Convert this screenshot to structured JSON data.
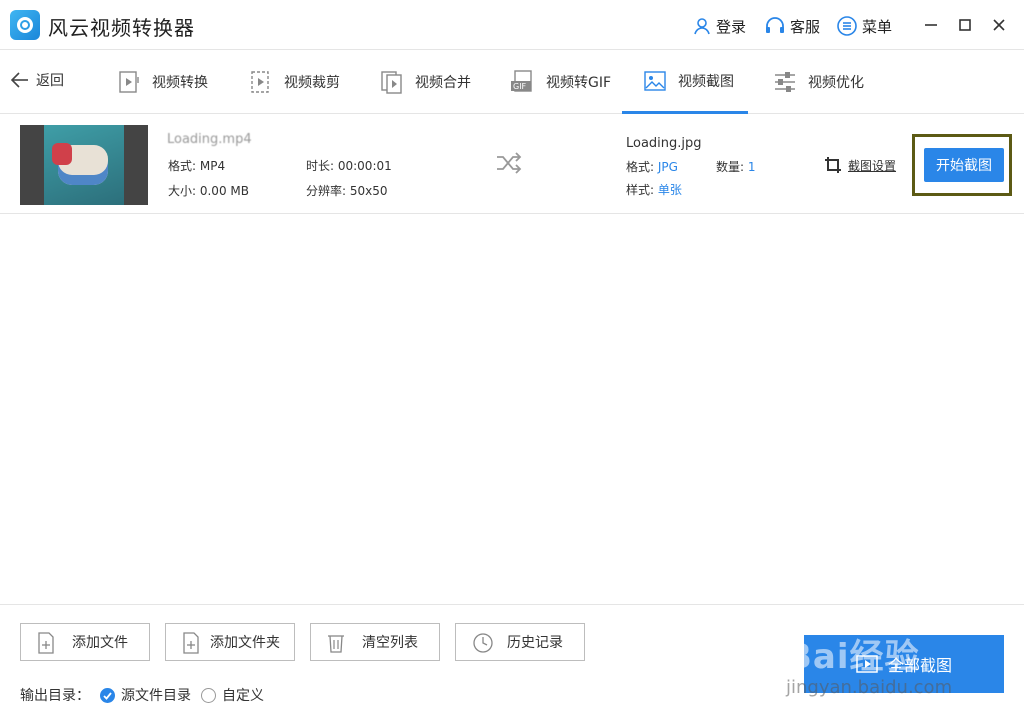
{
  "app": {
    "title": "风云视频转换器"
  },
  "header": {
    "login": "登录",
    "support": "客服",
    "menu": "菜单"
  },
  "nav": {
    "back": "返回",
    "tabs": [
      {
        "label": "视频转换",
        "icon": "video-convert-icon"
      },
      {
        "label": "视频裁剪",
        "icon": "video-crop-icon"
      },
      {
        "label": "视频合并",
        "icon": "video-merge-icon"
      },
      {
        "label": "视频转GIF",
        "icon": "gif-icon"
      },
      {
        "label": "视频截图",
        "icon": "screenshot-icon",
        "active": true
      },
      {
        "label": "视频优化",
        "icon": "sliders-icon"
      }
    ]
  },
  "file": {
    "name": "Loading.mp4",
    "format": "格式: MP4",
    "size": "大小: 0.00 MB",
    "duration": "时长: 00:00:01",
    "resolution": "分辨率: 50x50"
  },
  "output": {
    "name": "Loading.jpg",
    "format_label": "格式:",
    "format_value": "JPG",
    "count_label": "数量:",
    "count_value": "1",
    "style_label": "样式:",
    "style_value": "单张",
    "crop_settings": "截图设置",
    "start_button": "开始截图"
  },
  "bottom": {
    "add_file": "添加文件",
    "add_folder": "添加文件夹",
    "clear_list": "清空列表",
    "history": "历史记录",
    "output_dir_label": "输出目录：",
    "option_source": "源文件目录",
    "option_custom": "自定义",
    "convert_all": "全部截图"
  },
  "watermark": {
    "text": "Bai经验",
    "url": "jingyan.baidu.com"
  },
  "colors": {
    "accent": "#2a86e8",
    "highlight_frame": "#5c5a14"
  }
}
